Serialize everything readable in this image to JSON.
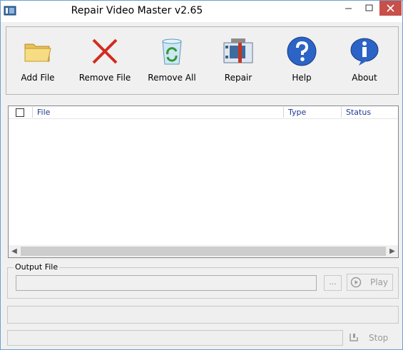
{
  "window": {
    "title": "Repair Video Master v2.65"
  },
  "toolbar": {
    "buttons": [
      {
        "label": "Add File",
        "icon": "folder-icon"
      },
      {
        "label": "Remove File",
        "icon": "red-x-icon"
      },
      {
        "label": "Remove All",
        "icon": "recycle-bin-icon"
      },
      {
        "label": "Repair",
        "icon": "repair-tools-icon"
      },
      {
        "label": "Help",
        "icon": "question-icon"
      },
      {
        "label": "About",
        "icon": "info-icon"
      }
    ]
  },
  "file_list": {
    "columns": [
      "File",
      "Type",
      "Status"
    ],
    "rows": []
  },
  "output": {
    "legend": "Output File",
    "value": "",
    "browse_label": "...",
    "play_label": "Play"
  },
  "progress": {
    "stop_label": "Stop"
  },
  "colors": {
    "close_button": "#c7504a",
    "header_text": "#1f3a93",
    "window_border": "#6e9fd0"
  }
}
